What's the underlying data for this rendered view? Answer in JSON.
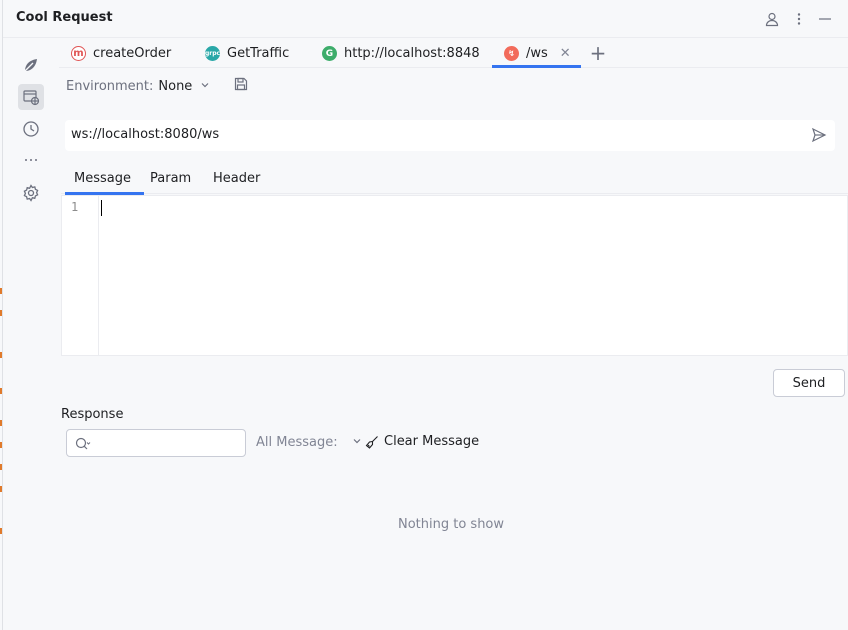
{
  "app": {
    "title": "Cool Request"
  },
  "tabs": [
    {
      "label": "createOrder",
      "icon": "m-circle-icon",
      "color": "#e05555"
    },
    {
      "label": "GetTraffic",
      "icon": "grpc-icon",
      "color": "#2aa8a8"
    },
    {
      "label": "http://localhost:8848",
      "icon": "g-circle-icon",
      "color": "#3dad6b"
    },
    {
      "label": "/ws",
      "icon": "ws-icon",
      "color": "#f26b5b",
      "active": true
    }
  ],
  "environment": {
    "label": "Environment:",
    "value": "None"
  },
  "url": {
    "value": "ws://localhost:8080/ws"
  },
  "message_tabs": [
    "Message",
    "Param",
    "Header"
  ],
  "editor": {
    "line_number": "1"
  },
  "send_button": {
    "label": "Send"
  },
  "response": {
    "label": "Response",
    "filter_label": "All Message:",
    "clear_label": "Clear Message",
    "empty_text": "Nothing to show"
  },
  "colors": {
    "accent": "#3574f0"
  }
}
